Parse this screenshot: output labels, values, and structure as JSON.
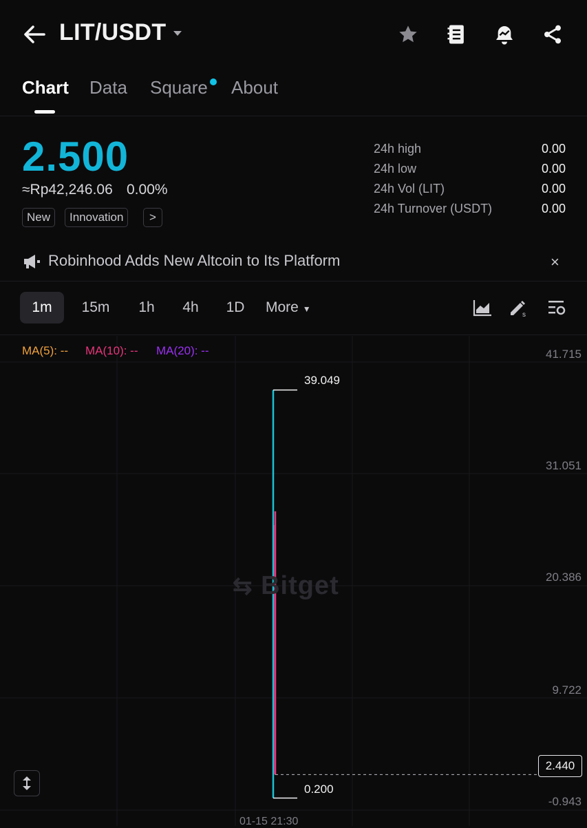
{
  "header": {
    "pair": "LIT/USDT",
    "icons": [
      "back-arrow-icon",
      "caret-down-icon",
      "star-icon",
      "notebook-icon",
      "alert-icon",
      "share-icon"
    ]
  },
  "tabs": [
    {
      "label": "Chart",
      "active": true
    },
    {
      "label": "Data",
      "active": false
    },
    {
      "label": "Square",
      "active": false,
      "dot": true
    },
    {
      "label": "About",
      "active": false
    }
  ],
  "ticker": {
    "price": "2.500",
    "fiat": "≈Rp42,246.06",
    "change": "0.00%",
    "badges": [
      "New",
      "Innovation"
    ],
    "more": ">",
    "stats": [
      {
        "label": "24h high",
        "value": "0.00"
      },
      {
        "label": "24h low",
        "value": "0.00"
      },
      {
        "label": "24h Vol (LIT)",
        "value": "0.00"
      },
      {
        "label": "24h Turnover (USDT)",
        "value": "0.00"
      }
    ]
  },
  "news": {
    "text": "Robinhood Adds New Altcoin to Its Platform",
    "close": "×"
  },
  "intervals": [
    "1m",
    "15m",
    "1h",
    "4h",
    "1D"
  ],
  "interval_more": "More",
  "active_interval": "1m",
  "ma": [
    {
      "label": "MA(5): --",
      "color": "#f0a23c"
    },
    {
      "label": "MA(10): --",
      "color": "#e9357a"
    },
    {
      "label": "MA(20): --",
      "color": "#9b30f2"
    }
  ],
  "colors": {
    "accent": "#12b5d8",
    "up": "#19c3d6",
    "down": "#e9357a"
  },
  "chart_data": {
    "type": "candlestick",
    "y_ticks": [
      "41.715",
      "31.051",
      "20.386",
      "9.722",
      "-0.943"
    ],
    "ylim": [
      -0.943,
      41.715
    ],
    "x_ticks": [
      "01-15 21:30"
    ],
    "candles": [
      {
        "open": 0.2,
        "high": 39.049,
        "low": 0.2,
        "close": 2.5,
        "color": "up"
      },
      {
        "open": 27.5,
        "high": 27.5,
        "low": 2.44,
        "close": 2.44,
        "color": "down"
      }
    ],
    "high_label": "39.049",
    "low_label": "0.200",
    "last_price": "2.440",
    "watermark": "Bitget"
  }
}
